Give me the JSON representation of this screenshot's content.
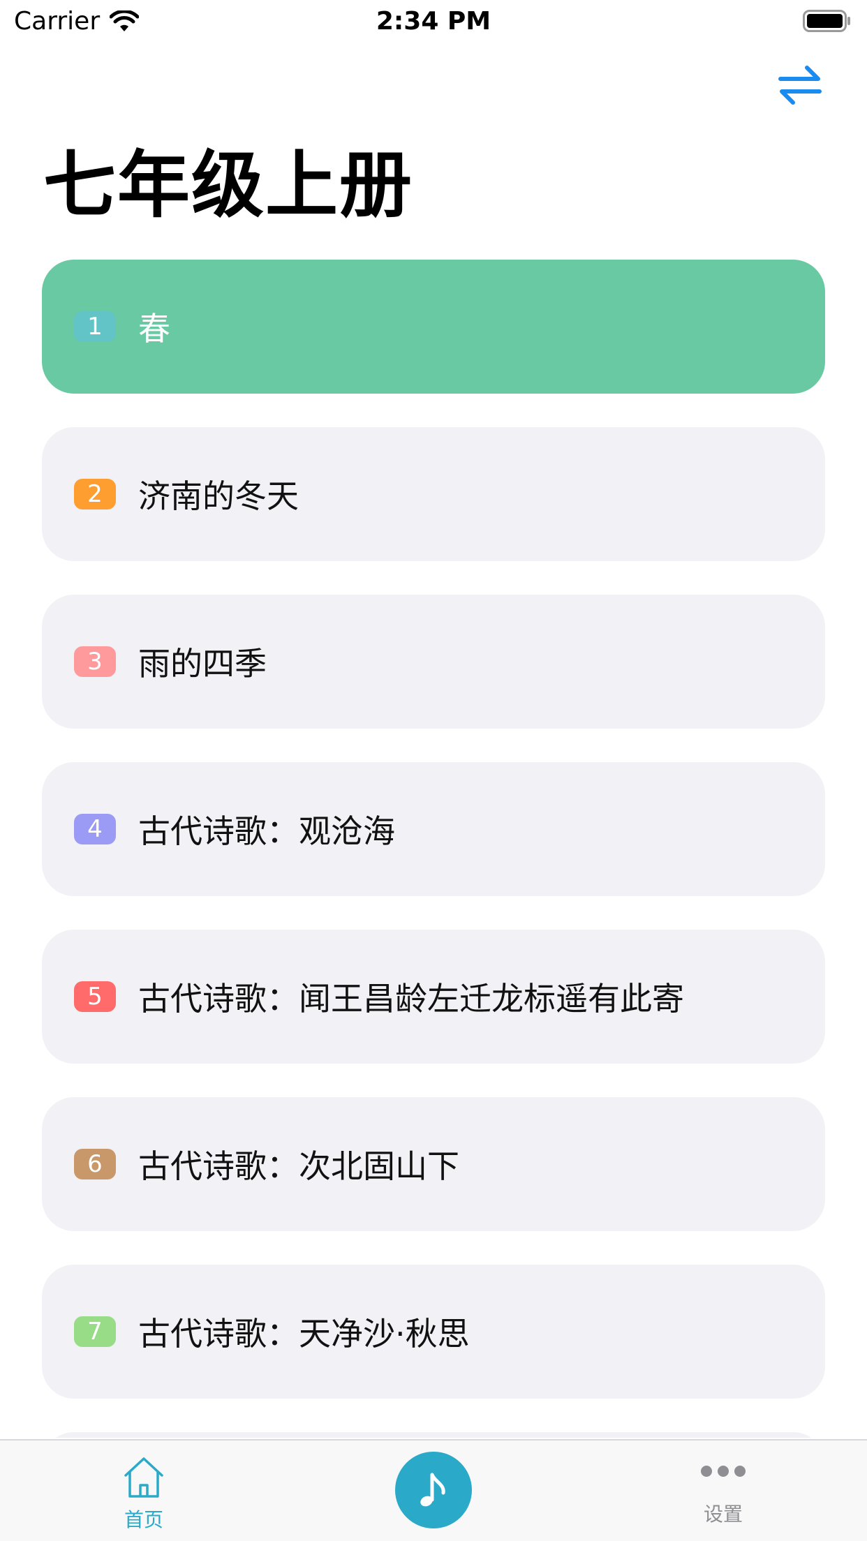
{
  "status_bar": {
    "carrier": "Carrier",
    "time": "2:34 PM"
  },
  "header": {
    "title": "七年级上册",
    "swap_icon": "swap-arrows-icon",
    "accent_color": "#1a8cf0"
  },
  "lessons": [
    {
      "number": "1",
      "title": "春",
      "badge_color": "#63c4c8",
      "active": true
    },
    {
      "number": "2",
      "title": "济南的冬天",
      "badge_color": "#ff9e30",
      "active": false
    },
    {
      "number": "3",
      "title": "雨的四季",
      "badge_color": "#ff9a9c",
      "active": false
    },
    {
      "number": "4",
      "title": "古代诗歌：观沧海",
      "badge_color": "#9b9af5",
      "active": false
    },
    {
      "number": "5",
      "title": "古代诗歌：闻王昌龄左迁龙标遥有此寄",
      "badge_color": "#ff6b6b",
      "active": false
    },
    {
      "number": "6",
      "title": "古代诗歌：次北固山下",
      "badge_color": "#c8976a",
      "active": false
    },
    {
      "number": "7",
      "title": "古代诗歌：天净沙·秋思",
      "badge_color": "#98dc88",
      "active": false
    }
  ],
  "tab_bar": {
    "home_label": "首页",
    "settings_label": "设置",
    "home_icon": "home-icon",
    "center_icon": "music-note-icon",
    "settings_icon": "more-dots-icon",
    "active_color": "#2aa9c8",
    "inactive_color": "#8e8e93"
  }
}
